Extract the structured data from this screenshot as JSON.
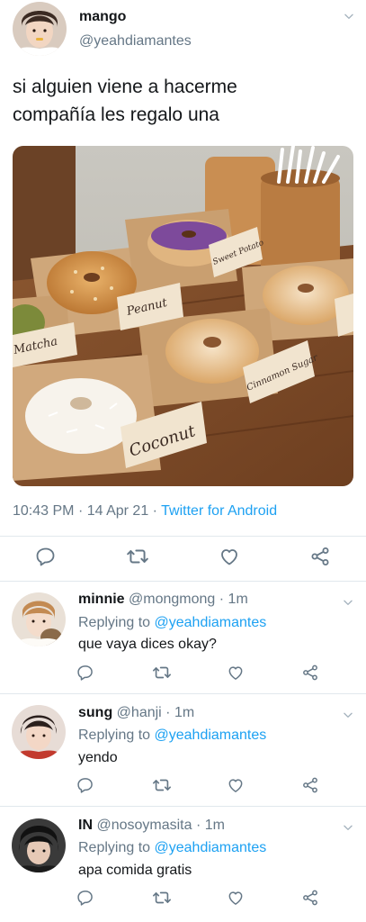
{
  "tweet": {
    "author_name": "mango",
    "author_handle": "@yeahdiamantes",
    "text_line1": "si alguien viene a hacerme",
    "text_line2": "compañía les regalo una",
    "photo_labels": [
      "Matcha",
      "Peanut",
      "Sweet Potato",
      "Cinnamon Sugar",
      "Coconut"
    ],
    "time": "10:43 PM",
    "dot1": "·",
    "date": "14 Apr 21",
    "dot2": "·",
    "source": "Twitter for Android"
  },
  "replies": [
    {
      "name": "minnie",
      "handle": "@mongmong",
      "dot": "·",
      "time": "1m",
      "replying_prefix": "Replying to",
      "replying_to": "@yeahdiamantes",
      "text": "que vaya dices okay?"
    },
    {
      "name": "sung",
      "handle": "@hanji",
      "dot": "·",
      "time": "1m",
      "replying_prefix": "Replying to",
      "replying_to": "@yeahdiamantes",
      "text": "yendo"
    },
    {
      "name": "IN",
      "handle": "@nosoymasita",
      "dot": "·",
      "time": "1m",
      "replying_prefix": "Replying to",
      "replying_to": "@yeahdiamantes",
      "text": "apa comida gratis"
    }
  ],
  "icons": [
    "reply-icon",
    "retweet-icon",
    "like-icon",
    "share-icon",
    "chevron-down-icon"
  ],
  "colors": {
    "link": "#1da1f2",
    "secondary": "#657786",
    "action_icon": "#657786",
    "divider": "#e1e8ed"
  }
}
